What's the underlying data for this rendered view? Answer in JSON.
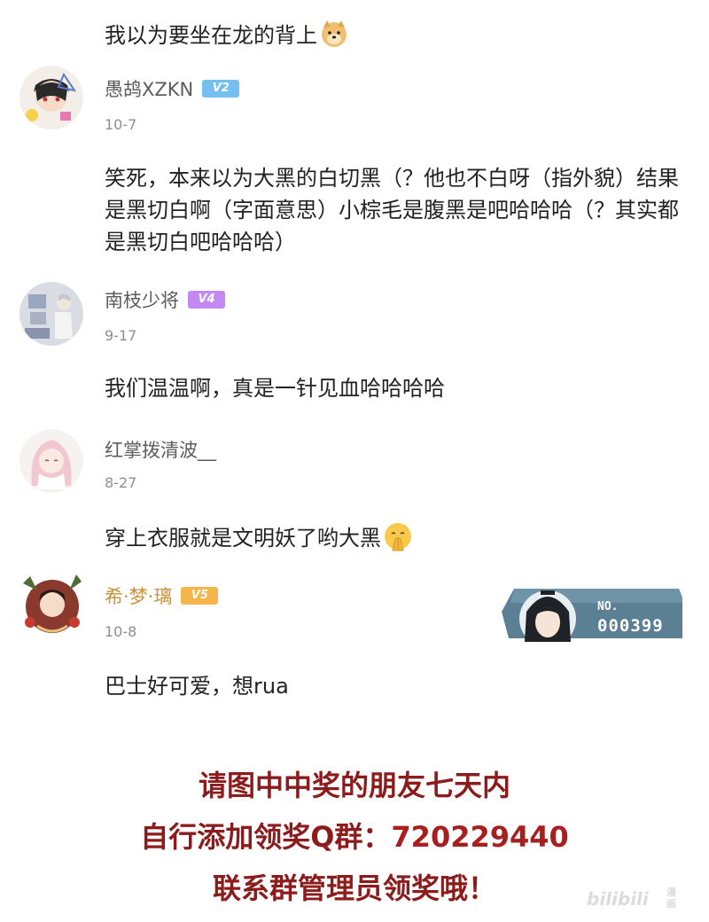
{
  "comments": [
    {
      "text": "我以为要坐在龙的背上",
      "emoji": "doge-emoji"
    },
    {
      "username": "愚鸪XZKN",
      "level": "V2",
      "date": "10-7",
      "text": "笑死，本来以为大黑的白切黑（？他也不白呀（指外貌）结果是黑切白啊（字面意思）小棕毛是腹黑是吧哈哈哈（？其实都是黑切白吧哈哈哈）"
    },
    {
      "username": "南枝少将",
      "level": "V4",
      "date": "9-17",
      "text": "我们温温啊，真是一针见血哈哈哈哈"
    },
    {
      "username": "红掌拨清波__",
      "date": "8-27",
      "text": "穿上衣服就是文明妖了哟大黑",
      "emoji": "pray-face-emoji"
    },
    {
      "username": "希·梦·璃",
      "level": "V5",
      "date": "10-8",
      "text": "巴士好可爱，想rua"
    }
  ],
  "fan_card": {
    "label": "NO.",
    "number": "000399"
  },
  "promo": {
    "line1": "请图中中奖的朋友七天内",
    "line2_prefix": "自行添加领奖Q群：",
    "line2_number": "720229440",
    "line3": "联系群管理员领奖哦！"
  },
  "watermark": {
    "logo": "bilibili",
    "sub": "漫画"
  },
  "colors": {
    "promo_text": "#8c1b1b",
    "level_v2": "#74bff0",
    "level_v4": "#c488f2",
    "level_v5": "#f5b54a",
    "vip_name": "#c8913a"
  }
}
